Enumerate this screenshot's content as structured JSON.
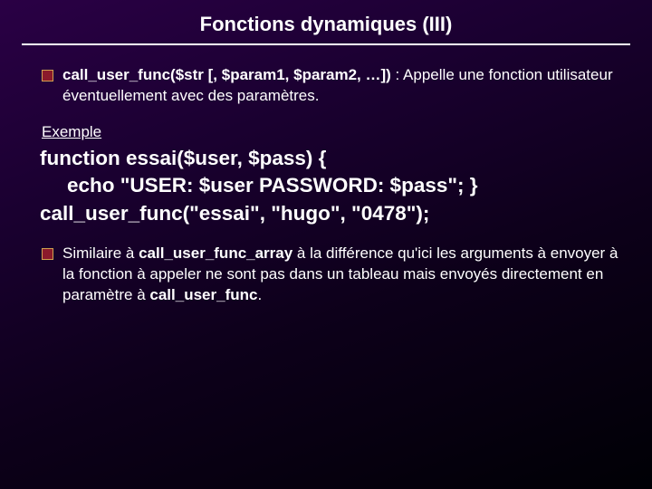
{
  "title": "Fonctions dynamiques (III)",
  "bullet1": {
    "bold": "call_user_func($str [, $param1, $param2, …])",
    "rest": " : Appelle une fonction utilisateur éventuellement avec des paramètres."
  },
  "exampleLabel": "Exemple",
  "code": {
    "line1": "function essai($user, $pass) {",
    "line2": "echo \"USER: $user PASSWORD: $pass\"; }",
    "line3": "call_user_func(\"essai\", \"hugo\", \"0478\");"
  },
  "bullet2": {
    "p1": "Similaire à ",
    "b1": "call_user_func_array",
    "p2": " à la différence qu'ici les arguments à envoyer à la fonction à appeler ne sont pas dans un tableau mais envoyés directement en paramètre à ",
    "b2": "call_user_func",
    "p3": "."
  }
}
